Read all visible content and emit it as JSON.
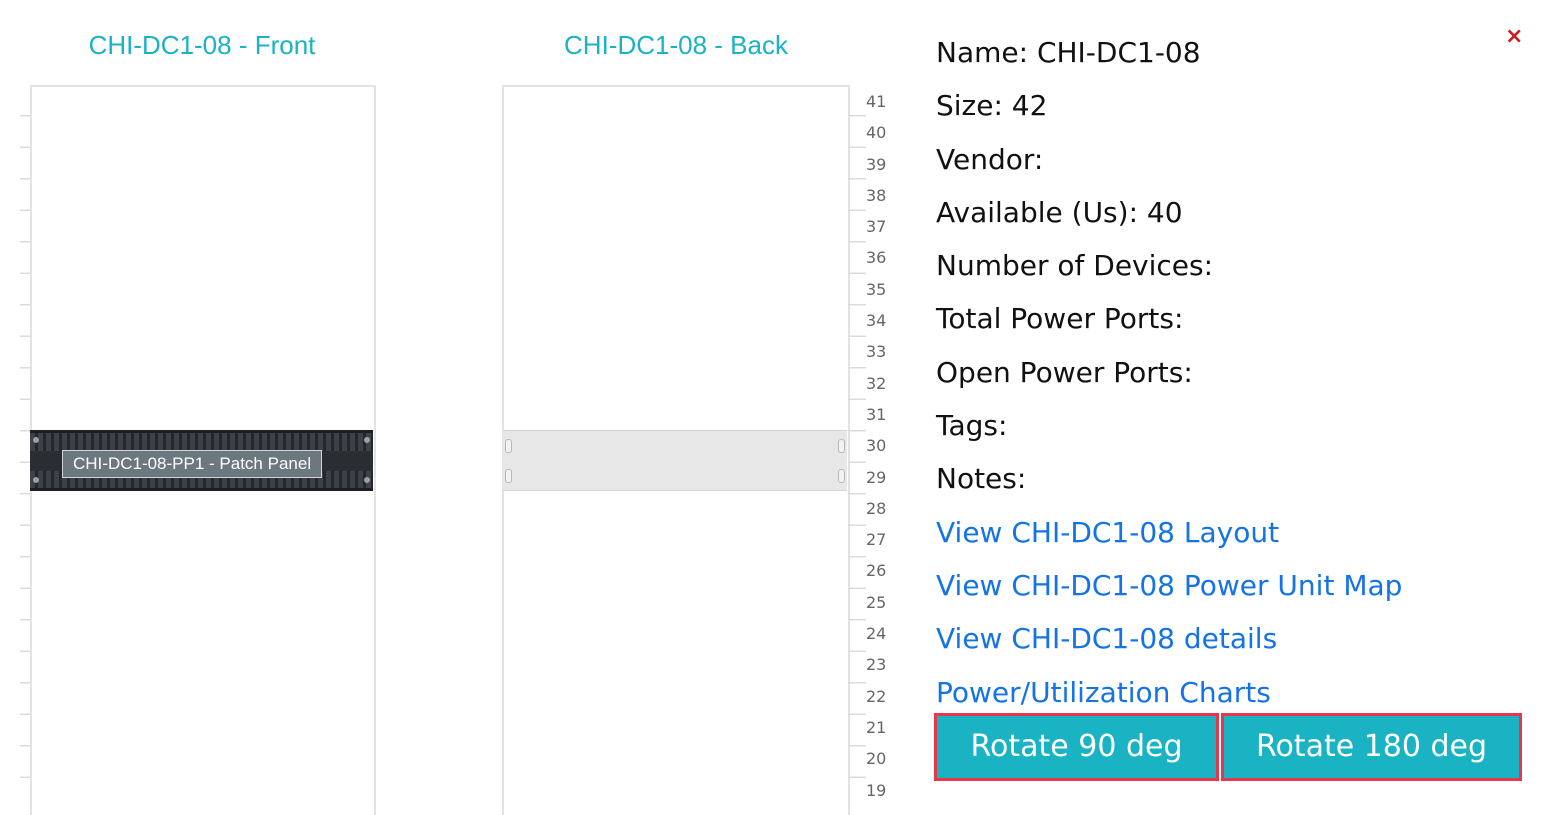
{
  "front": {
    "title": "CHI-DC1-08 - Front",
    "device_label": "CHI-DC1-08-PP1 - Patch Panel"
  },
  "back": {
    "title": "CHI-DC1-08 - Back"
  },
  "unit_numbers": [
    "41",
    "40",
    "39",
    "38",
    "37",
    "36",
    "35",
    "34",
    "33",
    "32",
    "31",
    "30",
    "29",
    "28",
    "27",
    "26",
    "25",
    "24",
    "23",
    "22",
    "21",
    "20",
    "19"
  ],
  "info": {
    "name": "Name: CHI-DC1-08",
    "size": "Size: 42",
    "vendor": "Vendor:",
    "available": "Available (Us): 40",
    "num_devices": "Number of Devices:",
    "total_power_ports": "Total Power Ports:",
    "open_power_ports": "Open Power Ports:",
    "tags": "Tags:",
    "notes": "Notes:"
  },
  "links": {
    "layout": "View CHI-DC1-08 Layout",
    "power_map": "View CHI-DC1-08 Power Unit Map",
    "details": "View CHI-DC1-08 details",
    "charts": "Power/Utilization Charts"
  },
  "buttons": {
    "rotate90": "Rotate 90 deg",
    "rotate180": "Rotate 180 deg",
    "close": "×"
  },
  "colors": {
    "accent": "#19b3c3",
    "link": "#1473e6",
    "close": "#d11a1a",
    "button_border": "#e8364a"
  }
}
